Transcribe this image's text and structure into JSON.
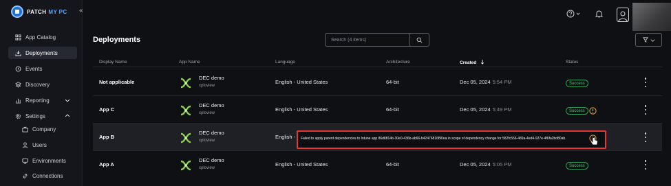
{
  "brand": {
    "name": "PATCH",
    "accent": "MY PC",
    "collapse_glyph": "«"
  },
  "sidebar": {
    "items": [
      {
        "label": "App Catalog"
      },
      {
        "label": "Deployments"
      },
      {
        "label": "Events"
      },
      {
        "label": "Discovery"
      },
      {
        "label": "Reporting"
      },
      {
        "label": "Settings"
      },
      {
        "label": "Company"
      },
      {
        "label": "Users"
      },
      {
        "label": "Environments"
      },
      {
        "label": "Connections"
      }
    ]
  },
  "page": {
    "title": "Deployments"
  },
  "search": {
    "placeholder": "Search (4 items)"
  },
  "table": {
    "columns": {
      "display_name": "Display Name",
      "app_name": "App Name",
      "language": "Language",
      "architecture": "Architecture",
      "created": "Created",
      "status": "Status"
    },
    "rows": [
      {
        "display_name": "Not applicable",
        "app_name": "DEC demo",
        "publisher": "xploview",
        "language": "English - United States",
        "architecture": "64-bit",
        "created_date": "Dec 05, 2024",
        "created_time": "5:54 PM",
        "status": "Success"
      },
      {
        "display_name": "App C",
        "app_name": "DEC demo",
        "publisher": "xploview",
        "language": "English - United States",
        "architecture": "64-bit",
        "created_date": "Dec 05, 2024",
        "created_time": "5:49 PM",
        "status": "Success"
      },
      {
        "display_name": "App B",
        "app_name": "DEC demo",
        "publisher": "xploview",
        "language": "English -",
        "architecture": "",
        "created_date": "",
        "created_time": "",
        "status": ""
      },
      {
        "display_name": "App A",
        "app_name": "DEC demo",
        "publisher": "xploview",
        "language": "English - United States",
        "architecture": "64-bit",
        "created_date": "Dec 05, 2024",
        "created_time": "5:05 PM",
        "status": "Success"
      }
    ]
  },
  "tooltip": {
    "text": "Failed to apply parent dependencies to Intune app 86d8814b-30e0-436b-ab66-b42476816f90ea in scope of dependency change for 582fc556-489a-4ed4-927e-4f6fa2bd80ab."
  },
  "colors": {
    "success": "#49c97a",
    "warning": "#e8a020",
    "highlight_border": "#e53935",
    "accent": "#5fa6ff"
  }
}
